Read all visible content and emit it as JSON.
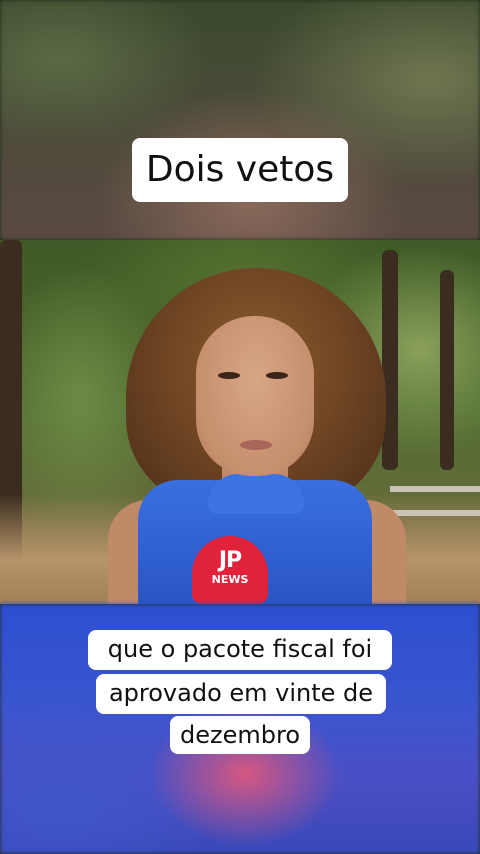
{
  "overlay": {
    "title": "Dois vetos",
    "subtitle_lines": [
      "que o pacote fiscal foi",
      "aprovado em vinte de",
      "dezembro"
    ]
  },
  "microphone": {
    "logo": "JP",
    "sub": "NEWS"
  },
  "colors": {
    "mic_red": "#e0223a",
    "blouse_blue": "#3a6fe0",
    "caption_bg": "#ffffff"
  }
}
